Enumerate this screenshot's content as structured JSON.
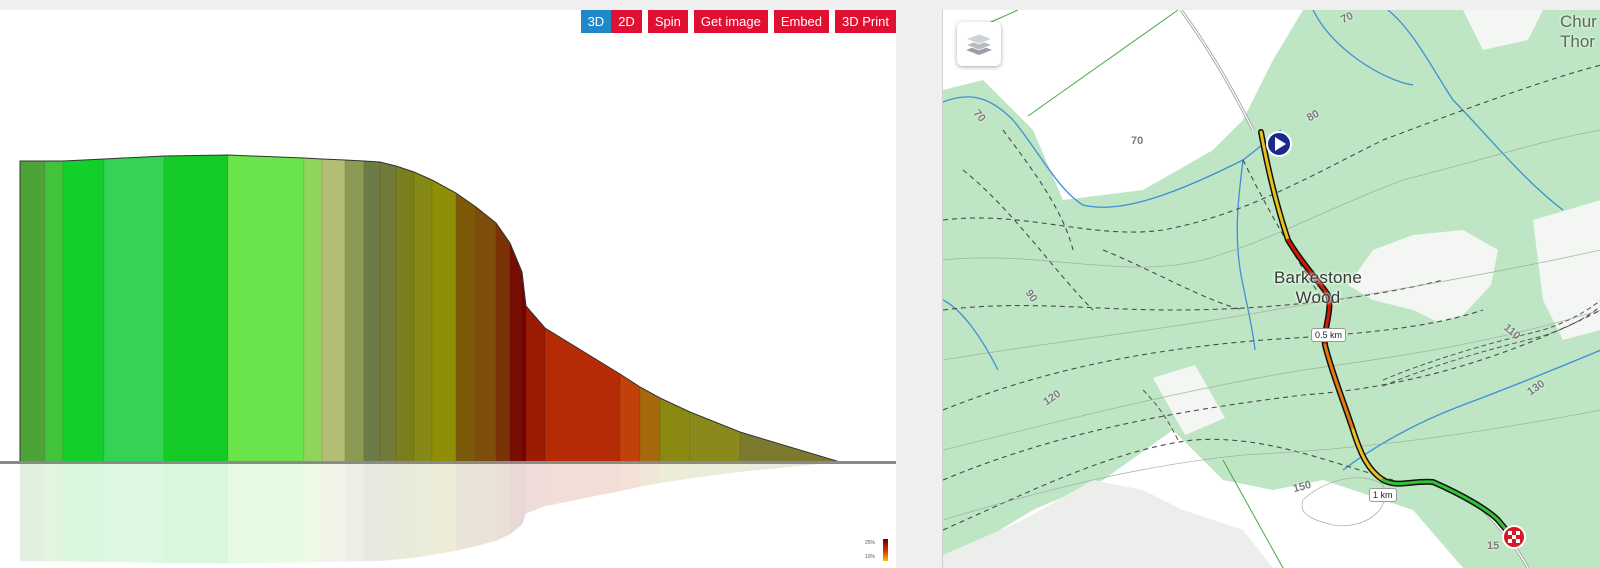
{
  "toolbar": {
    "view_3d": "3D",
    "view_2d": "2D",
    "spin": "Spin",
    "get_image": "Get image",
    "embed": "Embed",
    "print_3d": "3D Print"
  },
  "gradient_legend": {
    "top": "25%",
    "bottom": "10%"
  },
  "map": {
    "wood_name": "Barkestone\nWood",
    "corner_label": "Chur\nThor",
    "distance_markers": [
      "0.5 km",
      "1 km"
    ],
    "contours": [
      "70",
      "70",
      "70",
      "80",
      "90",
      "110",
      "120",
      "130",
      "150",
      "15"
    ]
  },
  "colors": {
    "button": "#e01033",
    "button_active": "#1e88c9",
    "woodland": "#bfe6c4",
    "water": "#3f8fd6"
  }
}
